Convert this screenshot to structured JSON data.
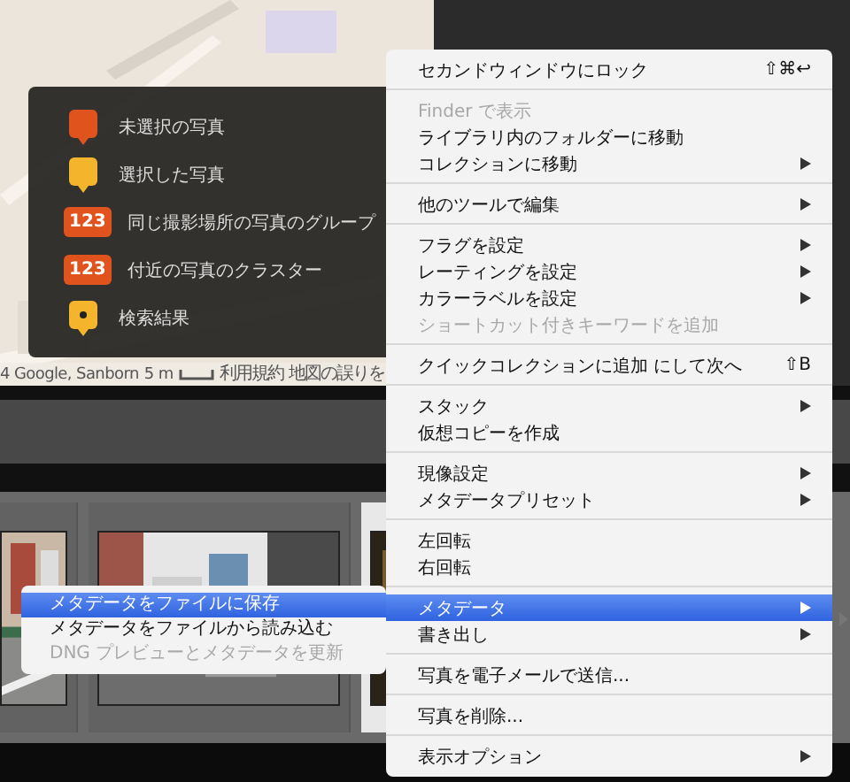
{
  "map": {
    "attribution": {
      "copyright": "4 Google, Sanborn",
      "scale": "5 m",
      "terms": "利用規約",
      "report": "地図の誤りを"
    }
  },
  "legend": {
    "items": [
      {
        "kind": "unselected",
        "label": "未選択の写真"
      },
      {
        "kind": "selected",
        "label": "選択した写真"
      },
      {
        "kind": "group",
        "badge": "123",
        "label": "同じ撮影場所の写真のグループ"
      },
      {
        "kind": "cluster",
        "badge": "123",
        "label": "付近の写真のクラスター"
      },
      {
        "kind": "search",
        "label": "検索結果"
      }
    ]
  },
  "context_menu": {
    "groups": [
      [
        {
          "label": "セカンドウィンドウにロック",
          "shortcut": "⇧⌘↩",
          "submenu": false,
          "disabled": false,
          "selected": false
        }
      ],
      [
        {
          "label": "Finder で表示",
          "submenu": false,
          "disabled": true,
          "selected": false
        },
        {
          "label": "ライブラリ内のフォルダーに移動",
          "submenu": false,
          "disabled": false,
          "selected": false
        },
        {
          "label": "コレクションに移動",
          "submenu": true,
          "disabled": false,
          "selected": false
        }
      ],
      [
        {
          "label": "他のツールで編集",
          "submenu": true,
          "disabled": false,
          "selected": false
        }
      ],
      [
        {
          "label": "フラグを設定",
          "submenu": true,
          "disabled": false,
          "selected": false
        },
        {
          "label": "レーティングを設定",
          "submenu": true,
          "disabled": false,
          "selected": false
        },
        {
          "label": "カラーラベルを設定",
          "submenu": true,
          "disabled": false,
          "selected": false
        },
        {
          "label": "ショートカット付きキーワードを追加",
          "submenu": false,
          "disabled": true,
          "selected": false
        }
      ],
      [
        {
          "label": "クイックコレクションに追加 にして次へ",
          "shortcut": "⇧B",
          "submenu": false,
          "disabled": false,
          "selected": false
        }
      ],
      [
        {
          "label": "スタック",
          "submenu": true,
          "disabled": false,
          "selected": false
        },
        {
          "label": "仮想コピーを作成",
          "submenu": false,
          "disabled": false,
          "selected": false
        }
      ],
      [
        {
          "label": "現像設定",
          "submenu": true,
          "disabled": false,
          "selected": false
        },
        {
          "label": "メタデータプリセット",
          "submenu": true,
          "disabled": false,
          "selected": false
        }
      ],
      [
        {
          "label": "左回転",
          "submenu": false,
          "disabled": false,
          "selected": false
        },
        {
          "label": "右回転",
          "submenu": false,
          "disabled": false,
          "selected": false
        }
      ],
      [
        {
          "label": "メタデータ",
          "submenu": true,
          "disabled": false,
          "selected": true
        },
        {
          "label": "書き出し",
          "submenu": true,
          "disabled": false,
          "selected": false
        }
      ],
      [
        {
          "label": "写真を電子メールで送信...",
          "submenu": false,
          "disabled": false,
          "selected": false
        }
      ],
      [
        {
          "label": "写真を削除...",
          "submenu": false,
          "disabled": false,
          "selected": false
        }
      ],
      [
        {
          "label": "表示オプション",
          "submenu": true,
          "disabled": false,
          "selected": false
        }
      ]
    ]
  },
  "submenu": {
    "items": [
      {
        "label": "メタデータをファイルに保存",
        "disabled": false,
        "selected": true
      },
      {
        "label": "メタデータをファイルから読み込む",
        "disabled": false,
        "selected": false
      },
      {
        "label": "DNG プレビューとメタデータを更新",
        "disabled": true,
        "selected": false
      }
    ]
  }
}
